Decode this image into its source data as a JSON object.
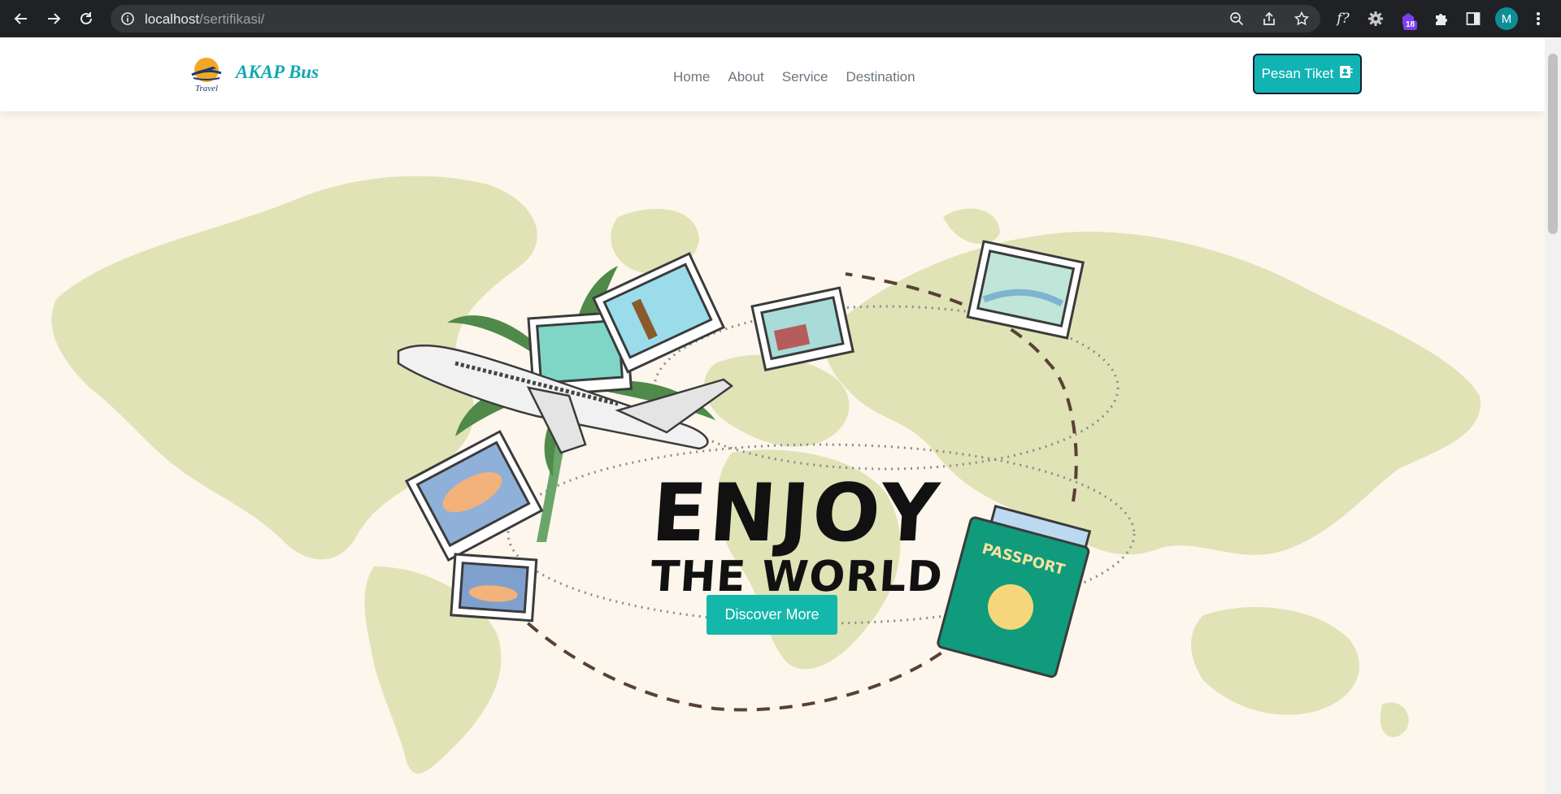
{
  "browser": {
    "url_host": "localhost",
    "url_path": "/sertifikasi/",
    "extension_badge": "18",
    "profile_initial": "M",
    "extension_text": "f?"
  },
  "site": {
    "brand": "AKAP Bus",
    "logo_text": "Travel",
    "nav": [
      "Home",
      "About",
      "Service",
      "Destination"
    ],
    "cta_label": "Pesan Tiket"
  },
  "hero": {
    "headline_line1": "ENJOY",
    "headline_line2": "THE WORLD",
    "passport_text": "PASSPORT",
    "button_label": "Discover More"
  },
  "colors": {
    "accent": "#11b3b3",
    "brand_text": "#11a9b0",
    "hero_bg": "#fdf6ec",
    "map": "#dfe3b6"
  }
}
